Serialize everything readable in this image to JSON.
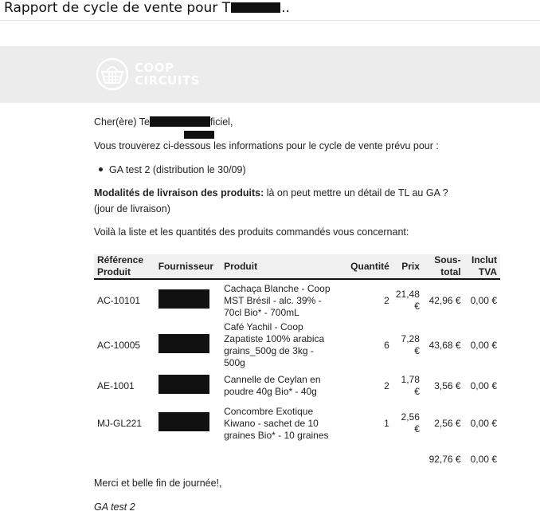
{
  "email": {
    "subject_start": "Rapport de cycle de vente pour T",
    "subject_end": ".."
  },
  "logo": {
    "line1": "COOP",
    "line2": "CIRCUITS"
  },
  "body": {
    "greeting_start": "Cher(ère) Te",
    "greeting_end": "ficiel,",
    "intro": "Vous trouverez ci-dessous les informations pour le cycle de vente prévu pour :",
    "cycle_item": "GA test 2 (distribution le 30/09)",
    "delivery_label": "Modalités de livraison des produits:",
    "delivery_text": " là on peut mettre un détail de TL au GA ? (jour de livraison)",
    "list_intro": "Voilà la liste et les quantités des produits commandés vous concernant:",
    "closing": "Merci et belle fin de journée!,",
    "signature": "GA test 2"
  },
  "table": {
    "headers": {
      "ref": "Référence Produit",
      "supplier": "Fournisseur",
      "product": "Produit",
      "qty": "Quantité",
      "price": "Prix",
      "subtotal": "Sous-total",
      "vat": "Inclut TVA"
    },
    "rows": [
      {
        "ref": "AC-10101",
        "product": "Cachaça Blanche - Coop MST Brésil - alc. 39% - 70cl Bio* - 700mL",
        "qty": "2",
        "price": "21,48 €",
        "subtotal": "42,96 €",
        "vat": "0,00 €"
      },
      {
        "ref": "AC-10005",
        "product": "Café Yachil - Coop Zapatiste 100% arabica grains_500g de 3kg - 500g",
        "qty": "6",
        "price": "7,28 €",
        "subtotal": "43,68 €",
        "vat": "0,00 €"
      },
      {
        "ref": "AE-1001",
        "product": "Cannelle de Ceylan en poudre 40g Bio* - 40g",
        "qty": "2",
        "price": "1,78 €",
        "subtotal": "3,56 €",
        "vat": "0,00 €"
      },
      {
        "ref": "MJ-GL221",
        "product": "Concombre Exotique Kiwano - sachet de 10 graines Bio* - 10 graines",
        "qty": "1",
        "price": "2,56 €",
        "subtotal": "2,56 €",
        "vat": "0,00 €"
      }
    ],
    "totals": {
      "subtotal": "92,76 €",
      "vat": "0,00 €"
    }
  }
}
